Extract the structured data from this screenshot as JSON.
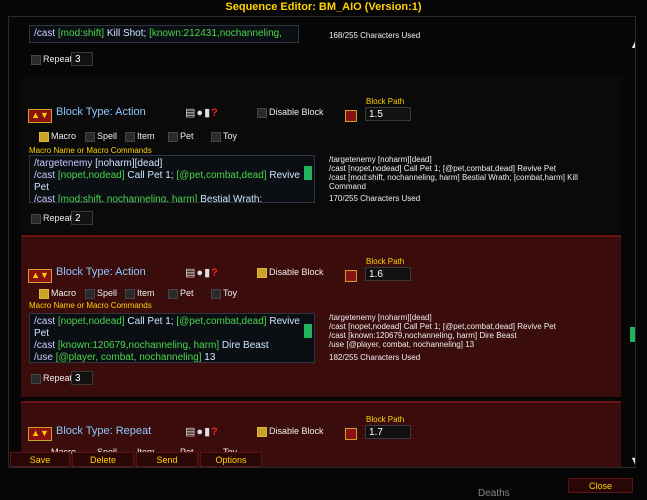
{
  "window": {
    "title": "Sequence Editor: BM_AIO (Version:1)"
  },
  "top_partial": {
    "line": [
      "/cast ",
      "[mod:shift]",
      " Kill Shot; ",
      "[known:212431,nochanneling,"
    ],
    "count": "168/255 Characters Used",
    "repeat_label": "Repeat",
    "repeat_value": "3"
  },
  "blocks": [
    {
      "type_label": "Block Type: Action",
      "disable_label": "Disable Block",
      "disabled": false,
      "path_label": "Block Path",
      "path_value": "1.5",
      "options": [
        "Macro",
        "Spell",
        "Item",
        "Pet",
        "Toy"
      ],
      "selected_option": "Macro",
      "macro_label": "Macro Name or Macro Commands",
      "editor_lines": [
        [
          "/targetenemy ",
          "[noharm]",
          "[dead]"
        ],
        [
          "/cast ",
          "[nopet,nodead]",
          " Call Pet 1; ",
          "[@pet,combat,dead]",
          " Revive"
        ],
        [
          "Pet",
          "",
          ""
        ],
        [
          "/cast ",
          "[mod:shift, nochanneling, harm]",
          " Bestial Wrath;"
        ]
      ],
      "preview": [
        "/targetenemy [noharm][dead]",
        "/cast [nopet,nodead] Call Pet 1; [@pet,combat,dead] Revive Pet",
        "/cast [mod:shift, nochanneling, harm] Bestial Wrath; [combat,harm] Kill",
        "Command"
      ],
      "count": "170/255 Characters Used",
      "repeat_label": "Repeat",
      "repeat_value": "2"
    },
    {
      "type_label": "Block Type: Action",
      "disable_label": "Disable Block",
      "disabled": true,
      "path_label": "Block Path",
      "path_value": "1.6",
      "options": [
        "Macro",
        "Spell",
        "Item",
        "Pet",
        "Toy"
      ],
      "selected_option": "Macro",
      "macro_label": "Macro Name or Macro Commands",
      "editor_lines": [
        [
          "/cast ",
          "[nopet,nodead]",
          " Call Pet 1; ",
          "[@pet,combat,dead]",
          " Revive"
        ],
        [
          "Pet",
          "",
          ""
        ],
        [
          "/cast ",
          "[known:120679,nochanneling, harm]",
          " Dire Beast"
        ],
        [
          "/use ",
          "[@player, combat, nochanneling]",
          "  13"
        ]
      ],
      "preview": [
        "/targetenemy [noharm][dead]",
        "/cast [nopet,nodead] Call Pet 1; [@pet,combat,dead] Revive Pet",
        "/cast [known:120679,nochanneling, harm] Dire Beast",
        "/use [@player, combat, nochanneling]  13"
      ],
      "count": "182/255 Characters Used",
      "repeat_label": "Repeat",
      "repeat_value": "3"
    },
    {
      "type_label": "Block Type: Repeat",
      "disable_label": "Disable Block",
      "disabled": true,
      "path_label": "Block Path",
      "path_value": "1.7",
      "options": [
        "Macro",
        "Spell",
        "Item",
        "Pet",
        "Toy"
      ]
    }
  ],
  "buttons": {
    "save": "Save",
    "delete": "Delete",
    "send": "Send",
    "options": "Options",
    "close": "Close"
  },
  "background_text": "Deaths",
  "icons": {
    "move_arrows": "up-down-arrows",
    "help": "question-icon",
    "trash": "trash-icon"
  },
  "colors": {
    "accent": "#ffd200",
    "selected_block": "#3a0c0c",
    "scroll_thumb": "#1fb45c"
  }
}
